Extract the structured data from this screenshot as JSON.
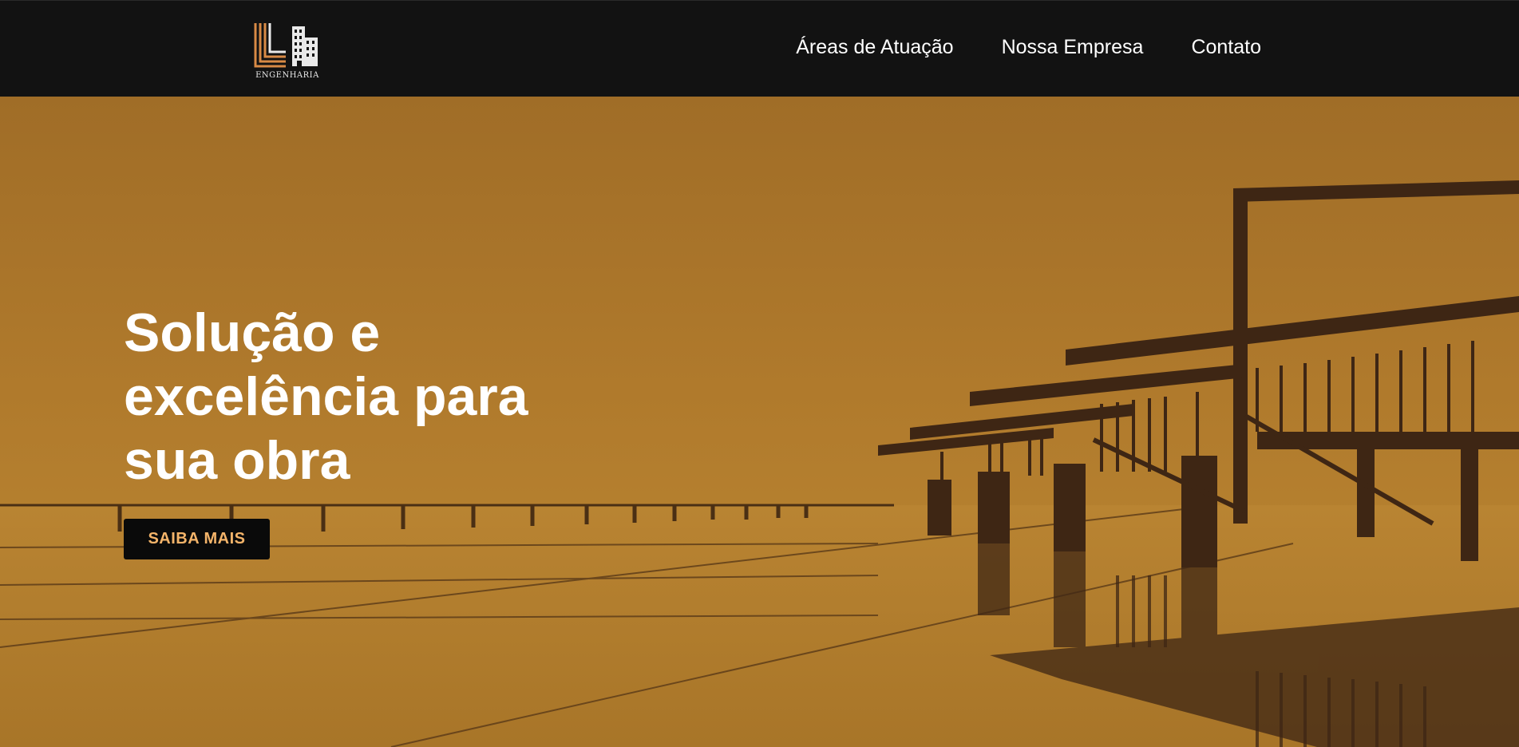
{
  "header": {
    "logo_text": "ENGENHARIA",
    "nav": [
      {
        "label": "Áreas de Atuação"
      },
      {
        "label": "Nossa Empresa"
      },
      {
        "label": "Contato"
      }
    ]
  },
  "hero": {
    "title_lines": [
      "Solução e",
      "excelência para",
      "sua obra"
    ],
    "cta_label": "SAIBA MAIS"
  },
  "colors": {
    "navbar": "#121212",
    "hero_tint": "#b07a2c",
    "cta_text": "#f4b46a",
    "logo_accent": "#d88a45"
  }
}
